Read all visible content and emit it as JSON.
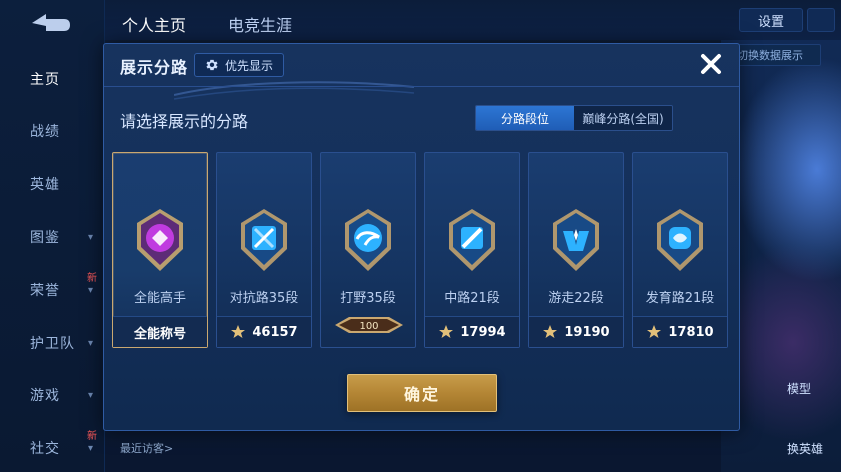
{
  "top_bar": {
    "tabs": [
      "个人主页",
      "电竞生涯"
    ],
    "settings_label": "设置",
    "right_button_label": "切换数据展示"
  },
  "left_nav": {
    "items": [
      "主页",
      "战绩",
      "英雄",
      "图鉴",
      "荣誉",
      "护卫队",
      "游戏",
      "社交"
    ],
    "active": "主页",
    "badge_text": "新"
  },
  "recent_visitors_label": "最近访客>",
  "hero_labels": {
    "model": "模型",
    "skin_hero": "换英雄"
  },
  "modal": {
    "title": "展示分路",
    "priority_label": "优先显示",
    "prompt": "请选择展示的分路",
    "tabs": [
      {
        "label": "分路段位",
        "active": true
      },
      {
        "label": "巅峰分路(全国)",
        "active": false
      }
    ],
    "cards": [
      {
        "name": "全能高手",
        "title": "全能称号",
        "selected": true,
        "icon": "allround-badge-icon"
      },
      {
        "name": "对抗路35段",
        "value": "46157",
        "icon": "clash-lane-badge-icon"
      },
      {
        "name": "打野35段",
        "ribbon": "100",
        "icon": "jungle-badge-icon"
      },
      {
        "name": "中路21段",
        "value": "17994",
        "icon": "mid-lane-badge-icon"
      },
      {
        "name": "游走22段",
        "value": "19190",
        "icon": "roam-badge-icon"
      },
      {
        "name": "发育路21段",
        "value": "17810",
        "icon": "farm-lane-badge-icon"
      }
    ],
    "confirm_label": "确定"
  },
  "colors": {
    "gold": "#caa870",
    "accent_blue": "#2d76d4",
    "panel": "#14305b"
  }
}
